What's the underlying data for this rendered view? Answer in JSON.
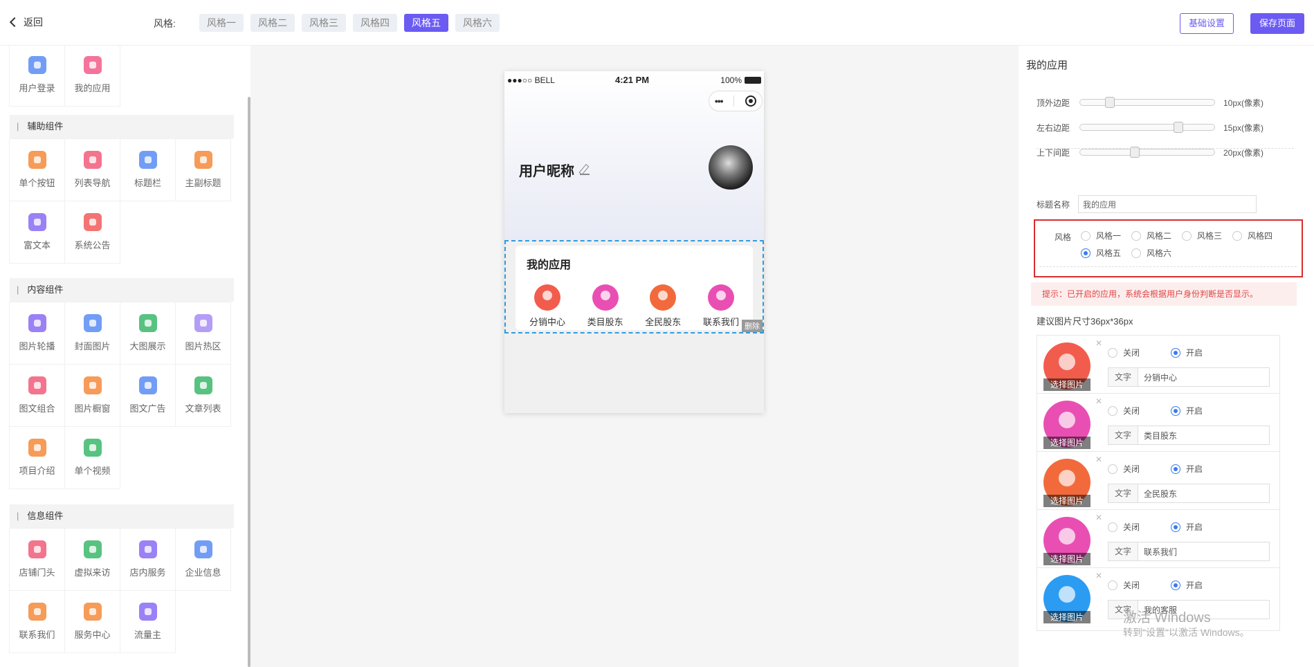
{
  "header": {
    "back_label": "返回",
    "style_label": "风格:",
    "style_tabs": [
      {
        "label": "风格一"
      },
      {
        "label": "风格二"
      },
      {
        "label": "风格三"
      },
      {
        "label": "风格四"
      },
      {
        "label": "风格五"
      },
      {
        "label": "风格六"
      }
    ],
    "active_tab": "风格五",
    "basic_settings": "基础设置",
    "save_page": "保存页面"
  },
  "left_panel": {
    "top_items": [
      {
        "label": "用户登录",
        "icon": "user-login-icon",
        "color": "#5a8df5"
      },
      {
        "label": "我的应用",
        "icon": "heart-icon",
        "color": "#f25c8a"
      }
    ],
    "sections": [
      {
        "title": "辅助组件",
        "items": [
          {
            "label": "单个按钮",
            "icon": "button-icon",
            "color": "#f58a3c"
          },
          {
            "label": "列表导航",
            "icon": "list-nav-icon",
            "color": "#f25c7a"
          },
          {
            "label": "标题栏",
            "icon": "title-bar-icon",
            "color": "#5a8df5"
          },
          {
            "label": "主副标题",
            "icon": "subtitle-icon",
            "color": "#f58a3c"
          },
          {
            "label": "富文本",
            "icon": "rich-text-icon",
            "color": "#8a6cf5"
          },
          {
            "label": "系统公告",
            "icon": "notice-icon",
            "color": "#f25c5c"
          }
        ]
      },
      {
        "title": "内容组件",
        "items": [
          {
            "label": "图片轮播",
            "icon": "carousel-icon",
            "color": "#8a6cf5"
          },
          {
            "label": "封面图片",
            "icon": "cover-image-icon",
            "color": "#5a8df5"
          },
          {
            "label": "大图展示",
            "icon": "big-image-icon",
            "color": "#3cb86b"
          },
          {
            "label": "图片热区",
            "icon": "hotspot-icon",
            "color": "#a88cf5"
          },
          {
            "label": "图文组合",
            "icon": "image-text-icon",
            "color": "#f25c7a"
          },
          {
            "label": "图片橱窗",
            "icon": "showcase-icon",
            "color": "#f58a3c"
          },
          {
            "label": "图文广告",
            "icon": "ad-icon",
            "color": "#5a8df5"
          },
          {
            "label": "文章列表",
            "icon": "article-list-icon",
            "color": "#3cb86b"
          },
          {
            "label": "项目介绍",
            "icon": "project-icon",
            "color": "#f58a3c"
          },
          {
            "label": "单个视频",
            "icon": "video-icon",
            "color": "#3cb86b"
          }
        ]
      },
      {
        "title": "信息组件",
        "items": [
          {
            "label": "店铺门头",
            "icon": "store-icon",
            "color": "#f25c7a"
          },
          {
            "label": "虚拟来访",
            "icon": "visitor-icon",
            "color": "#3cb86b"
          },
          {
            "label": "店内服务",
            "icon": "service-icon",
            "color": "#8a6cf5"
          },
          {
            "label": "企业信息",
            "icon": "company-icon",
            "color": "#5a8df5"
          },
          {
            "label": "联系我们",
            "icon": "contact-icon",
            "color": "#f58a3c"
          },
          {
            "label": "服务中心",
            "icon": "service-center-icon",
            "color": "#f58a3c"
          },
          {
            "label": "流量主",
            "icon": "traffic-icon",
            "color": "#8a6cf5"
          }
        ]
      }
    ]
  },
  "phone": {
    "status_left": "●●●○○ BELL",
    "status_time": "4:21 PM",
    "status_right": "100%",
    "nickname": "用户昵称",
    "my_app_title": "我的应用",
    "apps": [
      {
        "label": "分销中心",
        "color": "#f25c4c"
      },
      {
        "label": "类目股东",
        "color": "#e94fb3"
      },
      {
        "label": "全民股东",
        "color": "#f26a3c"
      },
      {
        "label": "联系我们",
        "color": "#e94fb3"
      }
    ],
    "delete_label": "删除"
  },
  "right_panel": {
    "title": "我的应用",
    "sliders": [
      {
        "label": "顶外边距",
        "value_text": "10px(像素)",
        "fraction": 0.2
      },
      {
        "label": "左右边距",
        "value_text": "15px(像素)",
        "fraction": 0.75
      },
      {
        "label": "上下间距",
        "value_text": "20px(像素)",
        "fraction": 0.4
      }
    ],
    "title_name_label": "标题名称",
    "title_name_value": "我的应用",
    "style_label": "风格",
    "style_options": [
      {
        "label": "风格一",
        "selected": false
      },
      {
        "label": "风格二",
        "selected": false
      },
      {
        "label": "风格三",
        "selected": false
      },
      {
        "label": "风格四",
        "selected": false
      },
      {
        "label": "风格五",
        "selected": true
      },
      {
        "label": "风格六",
        "selected": false
      }
    ],
    "hint": "提示：已开启的应用，系统会根据用户身份判断是否显示。",
    "size_tip": "建议图片尺寸36px*36px",
    "off_label": "关闭",
    "on_label": "开启",
    "text_label": "文字",
    "pick_image": "选择图片",
    "app_items": [
      {
        "text": "分销中心",
        "enabled": true,
        "color": "#f25c4c"
      },
      {
        "text": "类目股东",
        "enabled": true,
        "color": "#e94fb3"
      },
      {
        "text": "全民股东",
        "enabled": true,
        "color": "#f26a3c"
      },
      {
        "text": "联系我们",
        "enabled": true,
        "color": "#e94fb3"
      },
      {
        "text": "我的客服",
        "enabled": true,
        "color": "#2c9cf2"
      }
    ]
  },
  "watermark": {
    "line1": "激活 Windows",
    "line2": "转到\"设置\"以激活 Windows。"
  }
}
